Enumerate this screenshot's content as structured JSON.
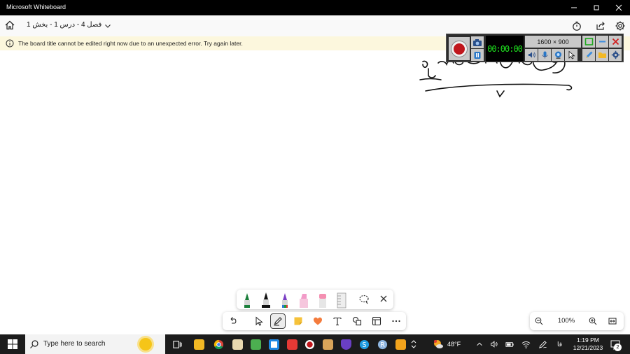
{
  "window": {
    "title": "Microsoft Whiteboard"
  },
  "header": {
    "board_title": "فصل 4 - درس 1 - بخش 1"
  },
  "infobar": {
    "message": "The board title cannot be edited right now due to an unexpected error. Try again later."
  },
  "recorder": {
    "timer": "00:00:00",
    "resolution": "1600 × 900"
  },
  "zoom": {
    "level": "100%"
  },
  "taskbar": {
    "search_placeholder": "Type here to search",
    "weather": "48°F",
    "language": "فا",
    "time": "1:19 PM",
    "date": "12/21/2023",
    "notification_count": "2"
  },
  "colors": {
    "recorder_timer": "#1ee01e",
    "recorder_record": "#c0161c",
    "infobar_bg": "#fcf7dd",
    "taskbar_bg": "#1c1c1c"
  }
}
